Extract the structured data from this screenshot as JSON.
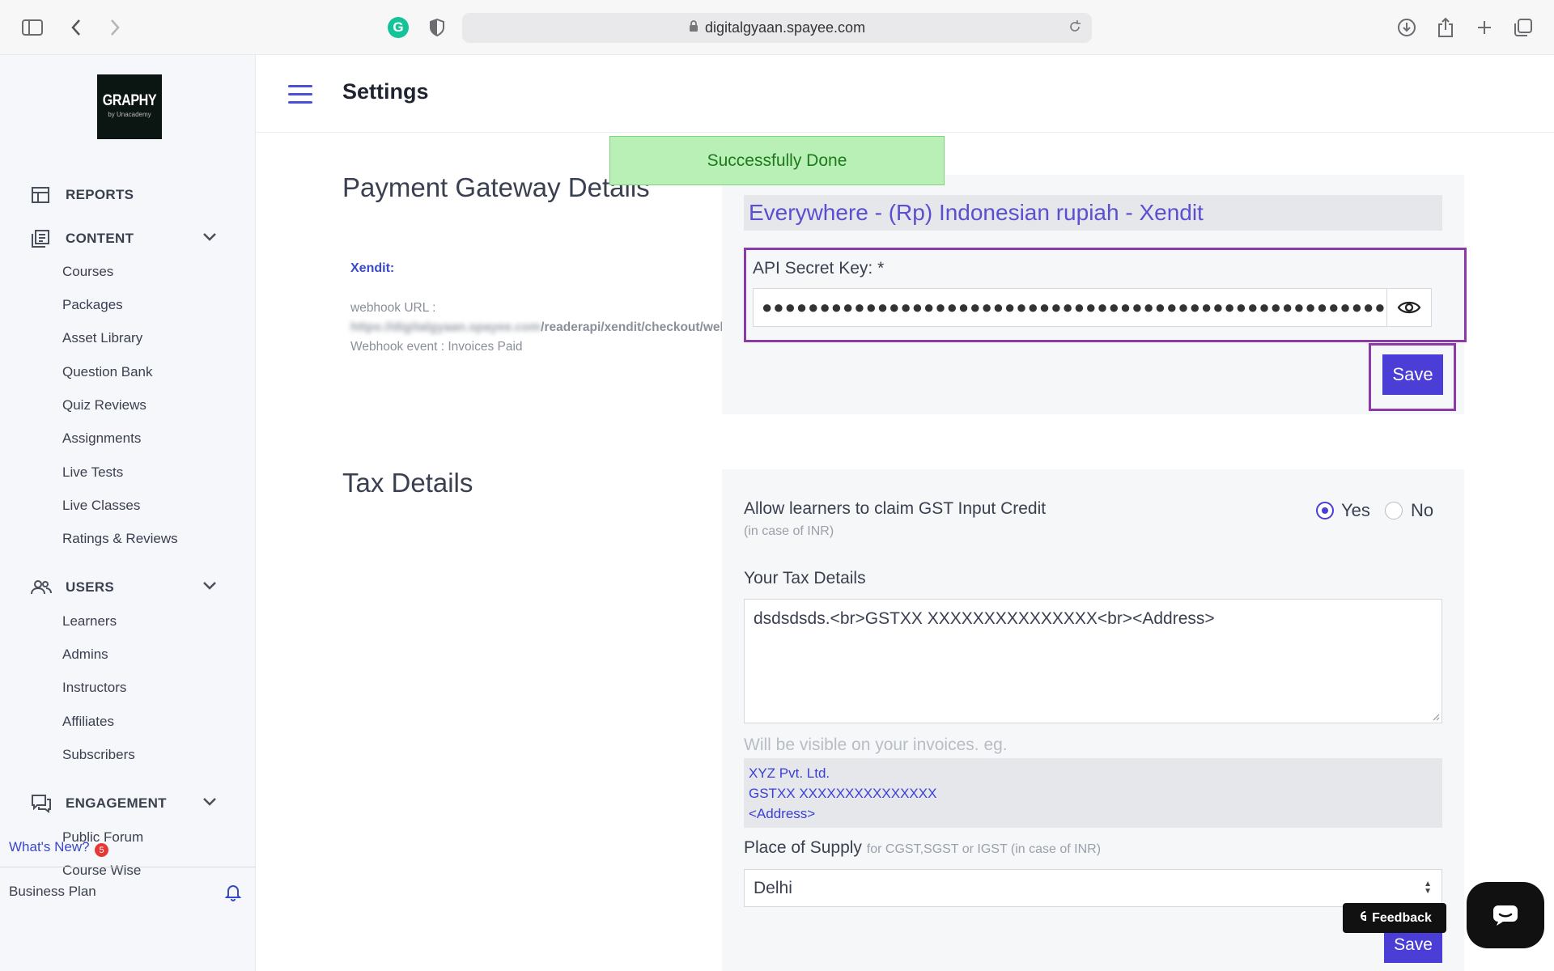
{
  "browser": {
    "url": "digitalgyaan.spayee.com"
  },
  "sidebar": {
    "logo_text": "GRAPHY",
    "logo_sub": "by Unacademy",
    "reports_label": "REPORTS",
    "content": {
      "label": "CONTENT",
      "items": [
        "Courses",
        "Packages",
        "Asset Library",
        "Question Bank",
        "Quiz Reviews",
        "Assignments",
        "Live Tests",
        "Live Classes",
        "Ratings & Reviews"
      ]
    },
    "users": {
      "label": "USERS",
      "items": [
        "Learners",
        "Admins",
        "Instructors",
        "Affiliates",
        "Subscribers"
      ]
    },
    "engagement": {
      "label": "ENGAGEMENT",
      "items": [
        "Public Forum",
        "Course Wise"
      ]
    },
    "whats_new": "What's New?",
    "whats_new_badge": "5",
    "business_plan": "Business Plan"
  },
  "header": {
    "title": "Settings"
  },
  "toast": {
    "message": "Successfully Done"
  },
  "payment": {
    "section_title": "Payment Gateway Details",
    "provider_label": "Xendit:",
    "webhook_url_label": "webhook URL :",
    "webhook_url_blurred": "https://digitalgyaan.spayee.com",
    "webhook_url_path": "/readerapi/xendit/checkout/webhook/success",
    "webhook_event": "Webhook event : Invoices Paid",
    "gateway_heading": "Everywhere - (Rp) Indonesian rupiah - Xendit",
    "api_secret_label": "API Secret Key: *",
    "api_secret_value": "●●●●●●●●●●●●●●●●●●●●●●●●●●●●●●●●●●●●●●●●●●●●●●●●●●●●●●●●●●●●●●●●●●●●●●●●●●●●●●●●●",
    "save_label": "Save"
  },
  "tax": {
    "section_title": "Tax Details",
    "gst_label": "Allow learners to claim GST Input Credit",
    "gst_sub": "(in case of INR)",
    "option_yes": "Yes",
    "option_no": "No",
    "selected": "Yes",
    "your_tax_label": "Your Tax Details",
    "your_tax_value": "dsdsdsds.<br>GSTXX XXXXXXXXXXXXXXX<br><Address>",
    "visible_note": "Will be visible on your invoices. eg.",
    "invoice_lines": [
      "XYZ Pvt. Ltd.",
      "GSTXX XXXXXXXXXXXXXXX",
      "<Address>"
    ],
    "supply_label": "Place of Supply",
    "supply_sub": "for CGST,SGST or IGST (in case of INR)",
    "supply_value": "Delhi",
    "save_label": "Save"
  },
  "widgets": {
    "feedback_label": "Feedback"
  }
}
